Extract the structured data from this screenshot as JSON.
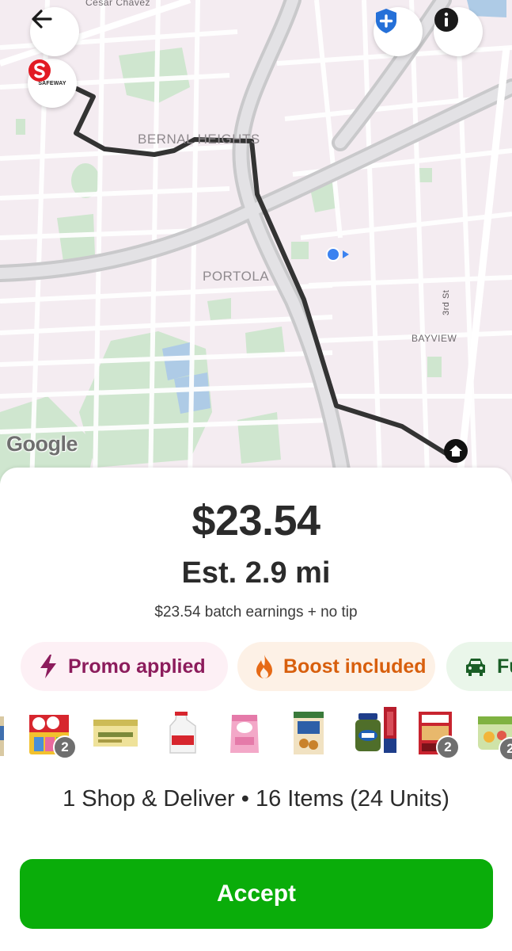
{
  "map": {
    "labels": {
      "cesar_chavez": "Cesar Chavez",
      "bernal_heights": "BERNAL HEIGHTS",
      "portola": "PORTOLA",
      "bayview": "BAYVIEW",
      "third_st": "3rd St"
    },
    "store_name": "SAFEWAY",
    "google_logo": "Google",
    "icons": {
      "back": "arrow-left-icon",
      "safety": "shield-plus-icon",
      "info": "info-icon",
      "destination": "home-icon",
      "location": "current-location-icon"
    }
  },
  "offer": {
    "earnings": "$23.54",
    "distance": "Est. 2.9 mi",
    "breakdown": "$23.54 batch earnings + no tip",
    "chips": [
      {
        "label": "Promo applied",
        "icon": "lightning-icon"
      },
      {
        "label": "Boost included",
        "icon": "flame-icon"
      },
      {
        "label": "Fu",
        "icon": "car-icon"
      }
    ],
    "items": [
      {
        "name": "Kool-Aid Jammers",
        "count": "2"
      },
      {
        "name": "Cozy Chamomile tea",
        "count": ""
      },
      {
        "name": "Milk gallon",
        "count": ""
      },
      {
        "name": "C&H sugar",
        "count": ""
      },
      {
        "name": "Cinnamon Toast Crunch",
        "count": ""
      },
      {
        "name": "Pickles jar",
        "count": ""
      },
      {
        "name": "Sweet Relish",
        "count": ""
      },
      {
        "name": "Hot Pockets",
        "count": "2"
      },
      {
        "name": "Dole fruit cup",
        "count": "2"
      }
    ],
    "summary": "1 Shop & Deliver • 16 Items (24 Units)",
    "accept_label": "Accept"
  },
  "colors": {
    "accept": "#0aad0a",
    "route": "#333333",
    "promo_text": "#8c1c5c",
    "boost_text": "#d85f0d",
    "fuel_text": "#1a5e26"
  }
}
